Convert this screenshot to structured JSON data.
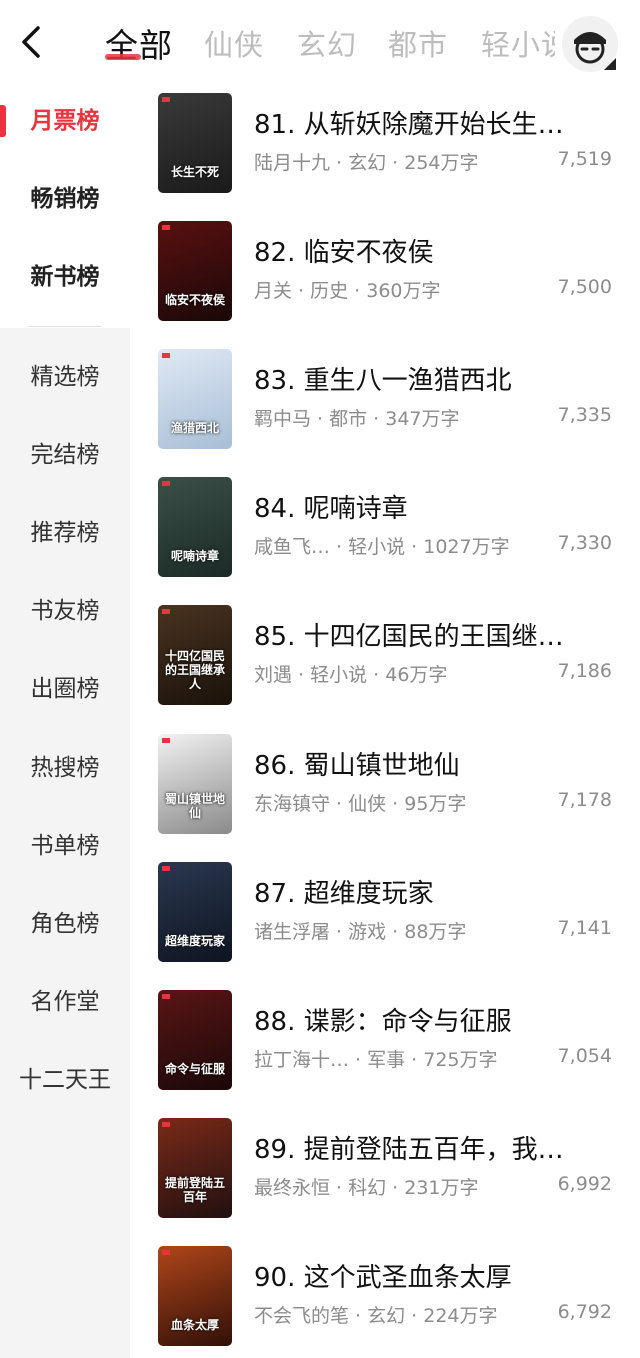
{
  "header": {
    "tabs": [
      "全部",
      "仙侠",
      "玄幻",
      "都市",
      "轻小说"
    ],
    "active_tab_index": 0
  },
  "sidebar": {
    "items": [
      "月票榜",
      "畅销榜",
      "新书榜",
      "精选榜",
      "完结榜",
      "推荐榜",
      "书友榜",
      "出圈榜",
      "热搜榜",
      "书单榜",
      "角色榜",
      "名作堂",
      "十二天王"
    ],
    "active_index": 0
  },
  "colors": {
    "accent": "#e8343f",
    "meta_gray": "#8c8c8c"
  },
  "books": [
    {
      "title": "81. 从斩妖除魔开始长生…",
      "meta": "陆月十九 · 玄幻 · 254万字",
      "count": "7,519",
      "cover_text": "长生不死",
      "cover_bg": [
        "#3a3a3a",
        "#1a1a1a"
      ]
    },
    {
      "title": "82. 临安不夜侯",
      "meta": "月关 · 历史 · 360万字",
      "count": "7,500",
      "cover_text": "临安不夜侯",
      "cover_bg": [
        "#5a1010",
        "#1a0808"
      ]
    },
    {
      "title": "83. 重生八一渔猎西北",
      "meta": "羁中马 · 都市 · 347万字",
      "count": "7,335",
      "cover_text": "渔猎西北",
      "cover_bg": [
        "#dfe9f5",
        "#a8bed6"
      ]
    },
    {
      "title": "84. 呢喃诗章",
      "meta": "咸鱼飞… · 轻小说 · 1027万字",
      "count": "7,330",
      "cover_text": "呢喃诗章",
      "cover_bg": [
        "#3b5048",
        "#1b2a26"
      ]
    },
    {
      "title": "85. 十四亿国民的王国继…",
      "meta": "刘遇 · 轻小说 · 46万字",
      "count": "7,186",
      "cover_text": "十四亿国民的王国继承人",
      "cover_bg": [
        "#4a3320",
        "#1a120a"
      ]
    },
    {
      "title": "86. 蜀山镇世地仙",
      "meta": "东海镇守 · 仙侠 · 95万字",
      "count": "7,178",
      "cover_text": "蜀山镇世地仙",
      "cover_bg": [
        "#f2f2f2",
        "#8a8a8a"
      ]
    },
    {
      "title": "87. 超维度玩家",
      "meta": "诸生浮屠 · 游戏 · 88万字",
      "count": "7,141",
      "cover_text": "超维度玩家",
      "cover_bg": [
        "#2a3850",
        "#0e1420"
      ]
    },
    {
      "title": "88. 谍影：命令与征服",
      "meta": "拉丁海十… · 军事 · 725万字",
      "count": "7,054",
      "cover_text": "命令与征服",
      "cover_bg": [
        "#5a1515",
        "#1a0808"
      ]
    },
    {
      "title": "89. 提前登陆五百年，我…",
      "meta": "最终永恒 · 科幻 · 231万字",
      "count": "6,992",
      "cover_text": "提前登陆五百年",
      "cover_bg": [
        "#7a2a18",
        "#201010"
      ]
    },
    {
      "title": "90. 这个武圣血条太厚",
      "meta": "不会飞的笔 · 玄幻 · 224万字",
      "count": "6,792",
      "cover_text": "血条太厚",
      "cover_bg": [
        "#b0461a",
        "#301008"
      ]
    }
  ]
}
